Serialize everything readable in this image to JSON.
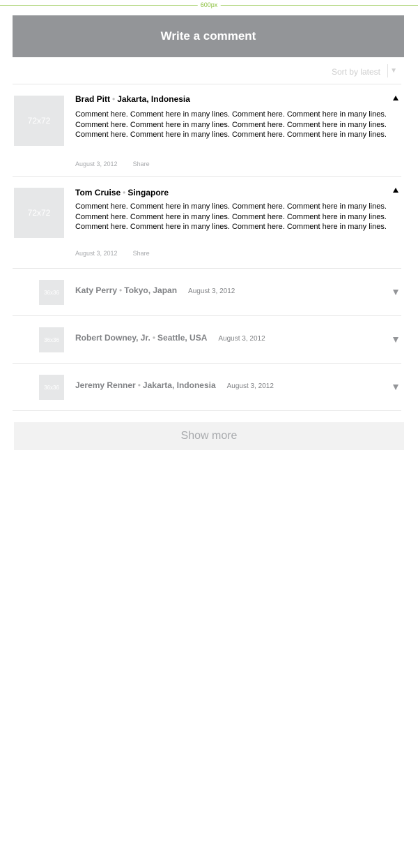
{
  "ruler": {
    "label": "600px"
  },
  "write_button": {
    "label": "Write a comment"
  },
  "sort": {
    "label": "Sort by latest",
    "caret": "▼"
  },
  "comments": [
    {
      "avatar": "72x72",
      "name": "Brad Pitt",
      "location": "Jakarta, Indonesia",
      "body": "Comment here. Comment here in many lines. Comment here. Comment here in many lines. Comment here. Comment here in many lines. Comment here. Comment here in many lines. Comment here. Comment here in many lines. Comment here. Comment here in many lines.",
      "date": "August 3, 2012",
      "share": "Share"
    },
    {
      "avatar": "72x72",
      "name": "Tom Cruise",
      "location": "Singapore",
      "body": "Comment here. Comment here in many lines. Comment here. Comment here in many lines. Comment here. Comment here in many lines. Comment here. Comment here in many lines. Comment here. Comment here in many lines. Comment here. Comment here in many lines.",
      "date": "August 3, 2012",
      "share": "Share"
    }
  ],
  "collapsed": [
    {
      "avatar": "36x36",
      "name": "Katy Perry",
      "location": "Tokyo, Japan",
      "date": "August 3, 2012"
    },
    {
      "avatar": "36x36",
      "name": "Robert Downey, Jr.",
      "location": "Seattle, USA",
      "date": "August 3, 2012"
    },
    {
      "avatar": "36x36",
      "name": "Jeremy Renner",
      "location": "Jakarta, Indonesia",
      "date": "August 3, 2012"
    }
  ],
  "show_more": {
    "label": "Show more"
  },
  "colors": {
    "header_bg": "#939598",
    "ruler": "#8cc03e",
    "placeholder": "#e6e7e8",
    "show_more_bg": "#f2f2f2"
  }
}
